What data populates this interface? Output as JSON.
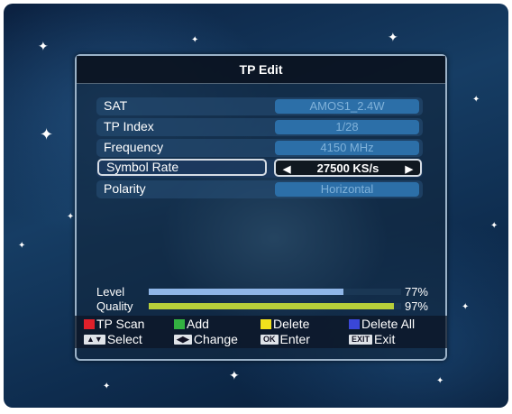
{
  "title": "TP Edit",
  "rows": [
    {
      "label": "SAT",
      "value": "AMOS1_2.4W"
    },
    {
      "label": "TP Index",
      "value": "1/28"
    },
    {
      "label": "Frequency",
      "value": "4150 MHz"
    },
    {
      "label": "Symbol Rate",
      "value": "27500 KS/s"
    },
    {
      "label": "Polarity",
      "value": "Horizontal"
    }
  ],
  "signal": {
    "level": {
      "label": "Level",
      "percent": "77%",
      "fraction": 0.77,
      "color": "#8fb6e8"
    },
    "quality": {
      "label": "Quality",
      "percent": "97%",
      "fraction": 0.97,
      "color": "#b7cf3a"
    }
  },
  "footer": {
    "tp_scan": {
      "label": "TP Scan",
      "color": "#e0202a"
    },
    "add": {
      "label": "Add",
      "color": "#33b241"
    },
    "delete": {
      "label": "Delete",
      "color": "#f2e21c"
    },
    "delete_all": {
      "label": "Delete All",
      "color": "#3a47d8"
    },
    "select": {
      "label": "Select",
      "icon": "up-down-arrows-icon"
    },
    "change": {
      "label": "Change",
      "icon": "left-right-arrows-icon"
    },
    "enter": {
      "label": "Enter",
      "key": "OK"
    },
    "exit": {
      "label": "Exit",
      "key": "EXIT"
    }
  }
}
